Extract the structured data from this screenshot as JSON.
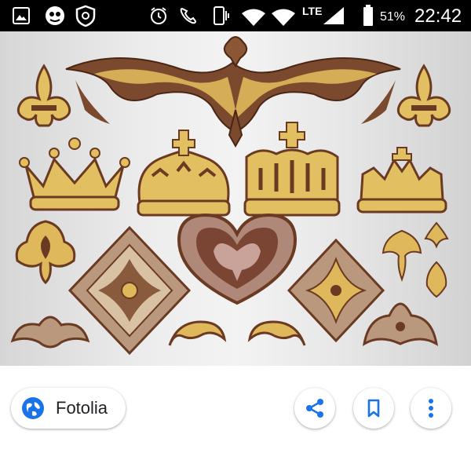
{
  "status_bar": {
    "time": "22:42",
    "battery_percent": "51%",
    "network_label": "LTE",
    "icons": [
      "gallery-icon",
      "app-icon",
      "shield-icon",
      "alarm-icon",
      "call-icon",
      "vibrate-icon",
      "wifi-calling-icon",
      "wifi-icon",
      "signal-icon",
      "battery-icon"
    ]
  },
  "image": {
    "subject": "heraldic ornaments, crowns, fleur-de-lis",
    "colors": {
      "gold": "#d9ad4f",
      "brown": "#6b3a22",
      "mauve": "#a88476",
      "background": "#ebebeb"
    }
  },
  "bottom_bar": {
    "source_name": "Fotolia",
    "actions": [
      "share-icon",
      "bookmark-icon",
      "more-vert-icon"
    ],
    "accent_color": "#1a73e8"
  }
}
